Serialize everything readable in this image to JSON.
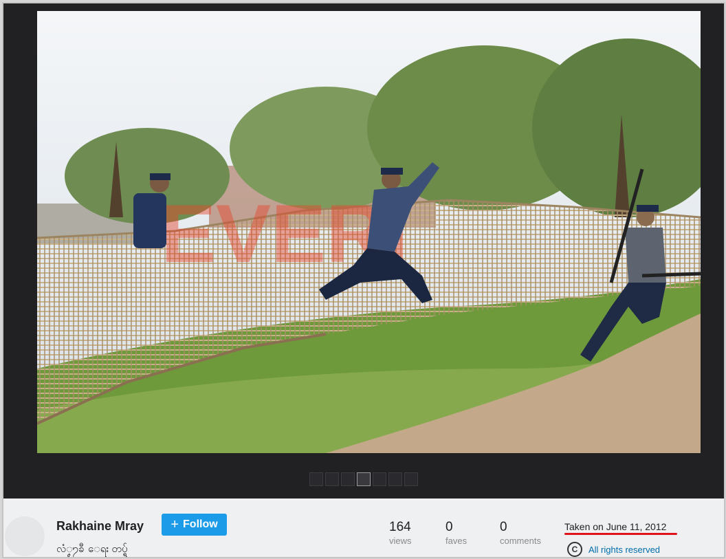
{
  "author": {
    "name": "Rakhaine Mray",
    "subtitle": "လံၞ႒ၶီ ေရး တပ္ရ်"
  },
  "follow_button": {
    "icon": "plus-icon",
    "label": "Follow"
  },
  "stats": [
    {
      "value": "164",
      "label": "views"
    },
    {
      "value": "0",
      "label": "faves"
    },
    {
      "value": "0",
      "label": "comments"
    }
  ],
  "taken": "Taken on June 11, 2012",
  "rights": {
    "icon": "copyright-icon",
    "label": "All rights reserved"
  },
  "pager": {
    "count": 7,
    "active_index": 3
  },
  "photo": {
    "subject": "photo-police-jumping-bamboo-fence"
  },
  "colors": {
    "accent": "#1c9be9",
    "highlight": "#e0131a",
    "link": "#006dac"
  }
}
